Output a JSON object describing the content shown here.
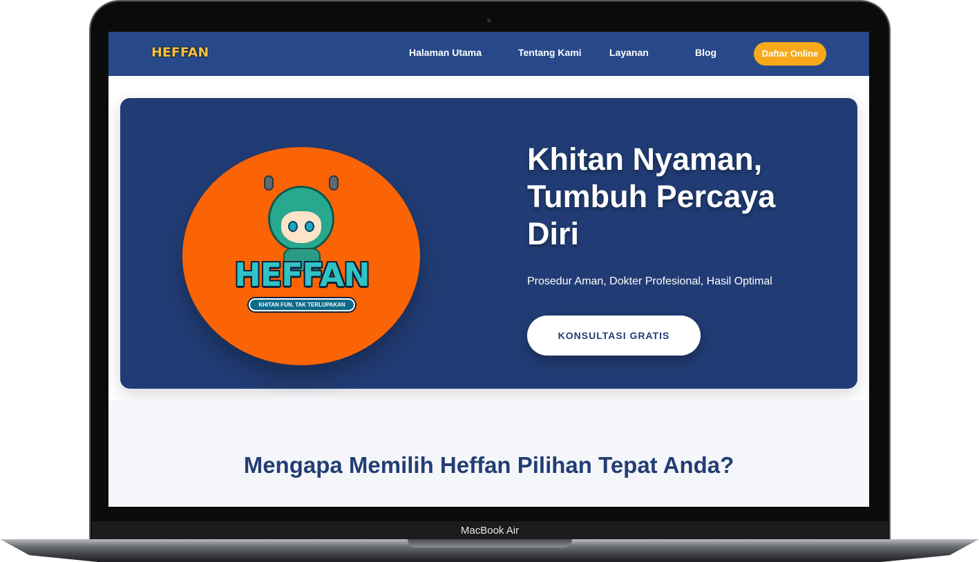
{
  "device": {
    "label": "MacBook Air"
  },
  "navbar": {
    "logo_text": "HEFFAN",
    "items": [
      {
        "label": "Halaman Utama"
      },
      {
        "label": "Tentang Kami"
      },
      {
        "label": "Layanan"
      },
      {
        "label": "Blog"
      }
    ],
    "cta_label": "Daftar Online",
    "background_color": "#27498a",
    "cta_color": "#f7a81b"
  },
  "hero": {
    "brand_name": "HEFFAN",
    "brand_tagline": "KHITAN FUN, TAK TERLUPAKAN",
    "title": "Khitan Nyaman, Tumbuh Percaya Diri",
    "subtitle": "Prosedur Aman, Dokter Profesional, Hasil Optimal",
    "cta_label": "KONSULTASI GRATIS",
    "background_color": "#213c74",
    "circle_color": "#fb6404"
  },
  "why_section": {
    "title": "Mengapa Memilih Heffan Pilihan Tepat Anda?"
  }
}
